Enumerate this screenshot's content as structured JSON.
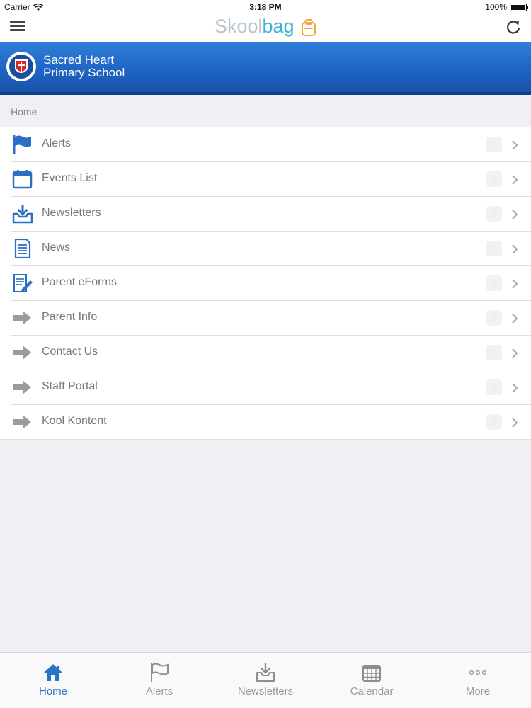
{
  "status_bar": {
    "carrier": "Carrier",
    "time": "3:18 PM",
    "battery": "100%"
  },
  "nav": {
    "logo_part1": "Skool",
    "logo_part2": "bag"
  },
  "school": {
    "name_line1": "Sacred Heart",
    "name_line2": "Primary School"
  },
  "breadcrumb": "Home",
  "menu_items": [
    {
      "label": "Alerts",
      "icon": "flag-icon",
      "badge": "0"
    },
    {
      "label": "Events List",
      "icon": "calendar-icon",
      "badge": "0"
    },
    {
      "label": "Newsletters",
      "icon": "inbox-download-icon",
      "badge": "0"
    },
    {
      "label": "News",
      "icon": "document-icon",
      "badge": "0"
    },
    {
      "label": "Parent eForms",
      "icon": "form-pen-icon",
      "badge": "0"
    },
    {
      "label": "Parent Info",
      "icon": "arrow-right-icon",
      "badge": "0"
    },
    {
      "label": "Contact Us",
      "icon": "arrow-right-icon",
      "badge": "0"
    },
    {
      "label": "Staff Portal",
      "icon": "arrow-right-icon",
      "badge": "0"
    },
    {
      "label": "Kool Kontent",
      "icon": "arrow-right-icon",
      "badge": "0"
    }
  ],
  "tabs": [
    {
      "label": "Home",
      "icon": "home-icon",
      "active": true
    },
    {
      "label": "Alerts",
      "icon": "flag-icon",
      "active": false
    },
    {
      "label": "Newsletters",
      "icon": "inbox-download-icon",
      "active": false
    },
    {
      "label": "Calendar",
      "icon": "calendar-grid-icon",
      "active": false
    },
    {
      "label": "More",
      "icon": "more-dots-icon",
      "active": false
    }
  ],
  "colors": {
    "banner_blue": "#1f64c4",
    "accent_blue": "#2a73c8",
    "logo_gray": "#b9c3cc",
    "logo_teal": "#3db0d6"
  }
}
